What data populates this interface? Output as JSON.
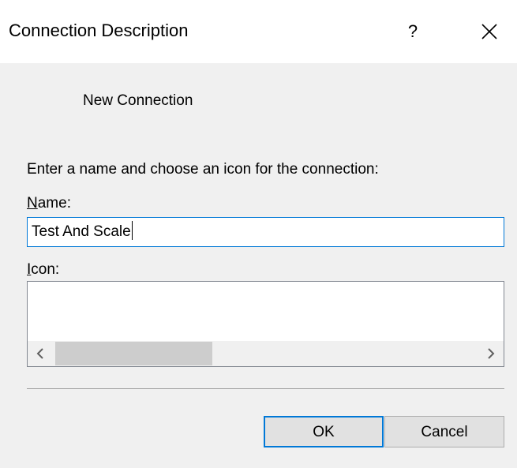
{
  "window": {
    "title": "Connection Description",
    "help_label": "?",
    "close_label": "Close"
  },
  "dialog": {
    "connection_name": "New Connection",
    "instruction": "Enter a name and choose an icon for the connection:"
  },
  "name_field": {
    "label_accel": "N",
    "label_rest": "ame:",
    "value": "Test And Scale"
  },
  "icon_field": {
    "label_accel": "I",
    "label_rest": "con:"
  },
  "buttons": {
    "ok_label": "OK",
    "cancel_label": "Cancel"
  },
  "colors": {
    "accent": "#0078d7",
    "dialog_background": "#f0f0f0",
    "titlebar_background": "#ffffff",
    "scroll_thumb": "#cdcdcd"
  },
  "icons": {
    "close": "close-icon",
    "scroll_left": "chevron-left-icon",
    "scroll_right": "chevron-right-icon"
  }
}
